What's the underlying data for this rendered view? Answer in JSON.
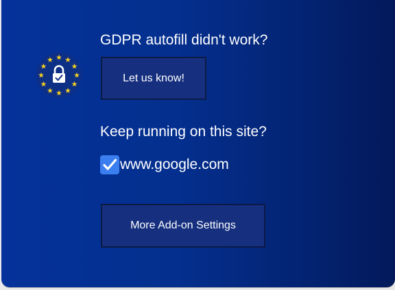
{
  "popup": {
    "logo_icon": "eu-stars-padlock-icon",
    "report_heading": "GDPR autofill didn't work?",
    "report_button_label": "Let us know!",
    "site_heading": "Keep running on this site?",
    "site_checkbox": {
      "label": "www.google.com",
      "checked": true
    },
    "settings_button_label": "More Add-on Settings"
  },
  "colors": {
    "background": "#04308f",
    "button_bg": "#16307f",
    "checkbox": "#3a7ef0",
    "stars": "#f5d21f"
  }
}
